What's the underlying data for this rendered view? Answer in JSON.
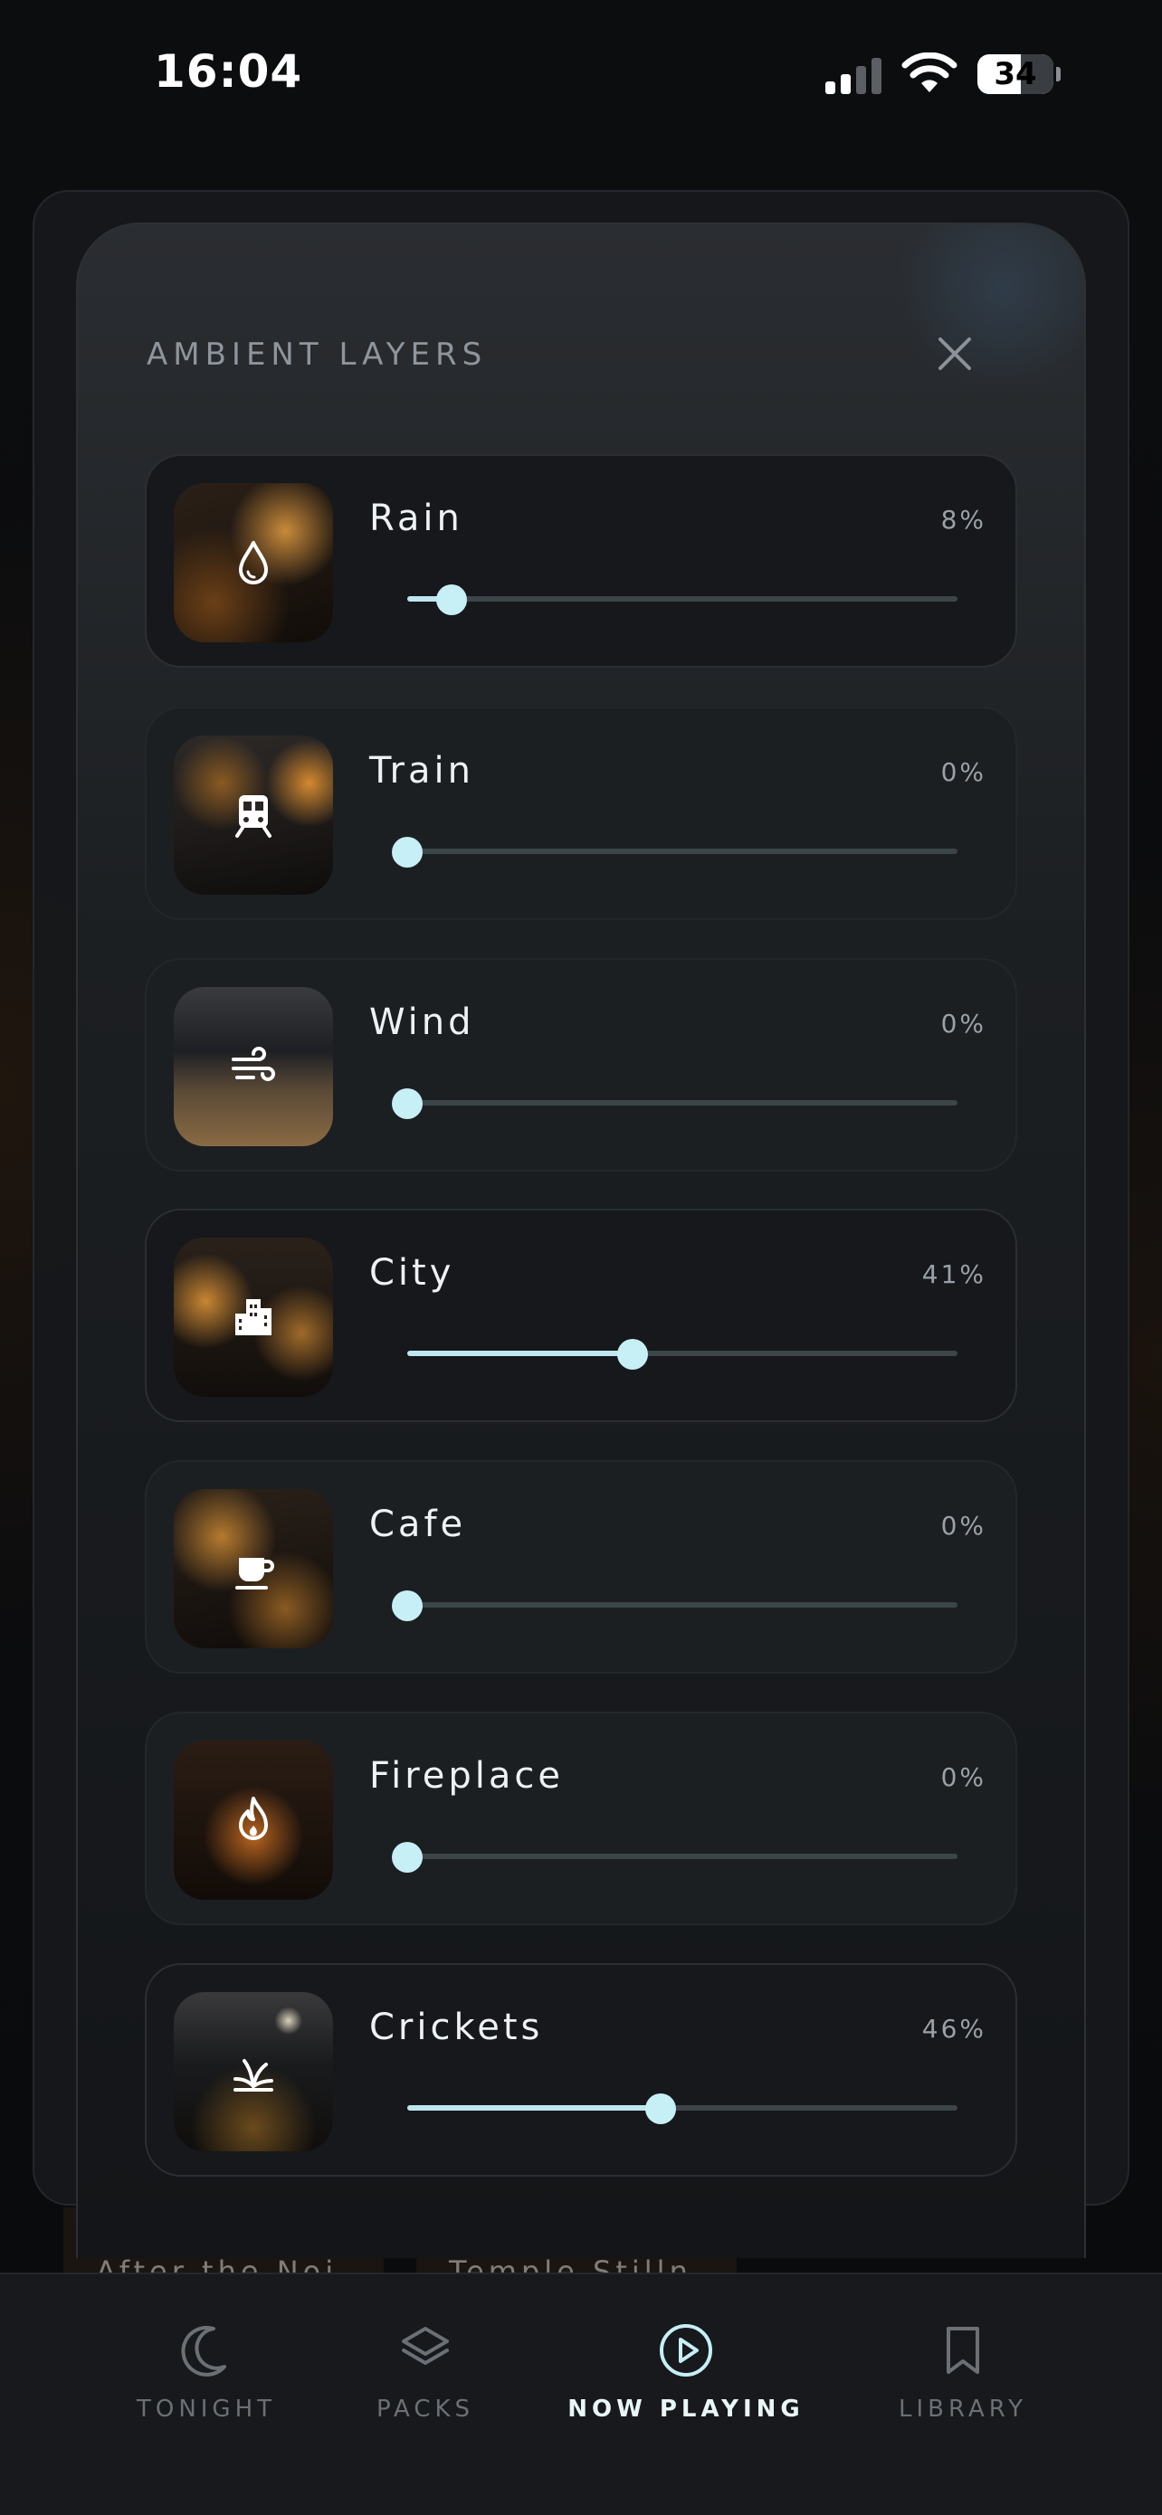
{
  "status_bar": {
    "time": "16:04",
    "battery": "34"
  },
  "sheet": {
    "title": "AMBIENT LAYERS",
    "close_icon": "close-icon",
    "layers": [
      {
        "name": "Rain",
        "percent_label": "8%",
        "value": 8,
        "icon": "water-drop-icon",
        "active": true
      },
      {
        "name": "Train",
        "percent_label": "0%",
        "value": 0,
        "icon": "train-icon",
        "active": false
      },
      {
        "name": "Wind",
        "percent_label": "0%",
        "value": 0,
        "icon": "wind-icon",
        "active": false
      },
      {
        "name": "City",
        "percent_label": "41%",
        "value": 41,
        "icon": "city-icon",
        "active": true
      },
      {
        "name": "Cafe",
        "percent_label": "0%",
        "value": 0,
        "icon": "coffee-cup-icon",
        "active": false
      },
      {
        "name": "Fireplace",
        "percent_label": "0%",
        "value": 0,
        "icon": "fire-icon",
        "active": false
      },
      {
        "name": "Crickets",
        "percent_label": "46%",
        "value": 46,
        "icon": "cricket-grass-icon",
        "active": true
      }
    ]
  },
  "background_cards": [
    {
      "label": "After the Noi"
    },
    {
      "label": "Temple Stilln"
    }
  ],
  "tab_bar": {
    "tabs": [
      {
        "label": "TONIGHT",
        "icon": "moon-icon",
        "active": false
      },
      {
        "label": "PACKS",
        "icon": "layers-icon",
        "active": false
      },
      {
        "label": "NOW PLAYING",
        "icon": "play-circle-icon",
        "active": true
      },
      {
        "label": "LIBRARY",
        "icon": "bookmark-icon",
        "active": false
      }
    ]
  },
  "colors": {
    "accent": "#c6eff6",
    "track": "#3c4548",
    "background": "#0b0c0e"
  }
}
